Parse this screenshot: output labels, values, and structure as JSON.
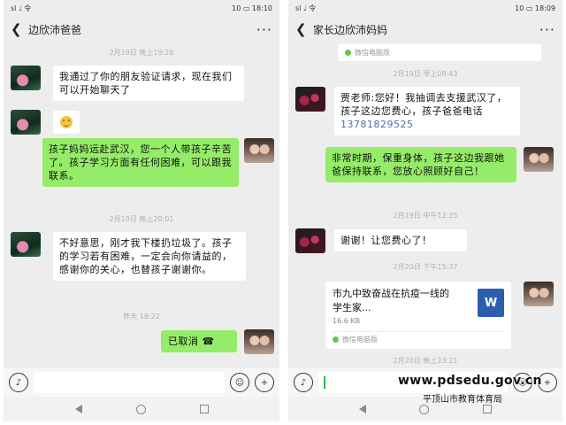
{
  "left_phone": {
    "status": {
      "left": "sl ♩ 令",
      "right": "10 ▭ 18:10"
    },
    "title": "边欣沛爸爸",
    "back_icon": "back-arrow-icon",
    "more_icon": "more-icon",
    "messages": [
      {
        "kind": "time",
        "text": "2月19日 晚上19:26"
      },
      {
        "kind": "in",
        "text": "我通过了你的朋友验证请求，现在我们可以开始聊天了"
      },
      {
        "kind": "in-emoji",
        "icon": "smile-emoji-icon"
      },
      {
        "kind": "out",
        "text": "孩子妈妈远赴武汉，您一个人带孩子辛苦了。孩子学习方面有任何困难，可以跟我联系。"
      },
      {
        "kind": "time",
        "text": "2月19日 晚上20:01"
      },
      {
        "kind": "in",
        "text": "不好意思，刚才我下楼扔垃圾了。孩子的学习若有困难，一定会向你请益的，感谢你的关心，也替孩子谢谢你。"
      },
      {
        "kind": "time",
        "text": "昨天 18:22"
      },
      {
        "kind": "out",
        "text": "已取消",
        "icon": "phone-hangup-icon"
      }
    ]
  },
  "right_phone": {
    "status": {
      "left": "sl ♩ 令",
      "right": "10 ▭ 18:09"
    },
    "title": "家长边欣沛妈妈",
    "back_icon": "back-arrow-icon",
    "more_icon": "more-icon",
    "messages": [
      {
        "kind": "source",
        "text": "微信电脑版"
      },
      {
        "kind": "time",
        "text": "2月19日 早上08:43"
      },
      {
        "kind": "in",
        "text": "贾老师:您好！我抽调去支援武汉了，孩子这边您费心，孩子爸爸电话",
        "phone": "13781829525"
      },
      {
        "kind": "out",
        "text": "非常时期，保重身体，孩子这边我跟她爸保持联系，您放心照顾好自己！"
      },
      {
        "kind": "time",
        "text": "2月19日 中午12:35"
      },
      {
        "kind": "in",
        "text": "谢谢！让您费心了！"
      },
      {
        "kind": "time",
        "text": "2月20日 下午15:37"
      },
      {
        "kind": "file",
        "title": "市九中致奋战在抗疫一线的学生家...",
        "size": "16.6 KB",
        "source": "微信电脑版",
        "badge": "W"
      },
      {
        "kind": "time",
        "text": "2月20日 晚上23:21"
      }
    ]
  },
  "input_bar": {
    "voice_icon": "voice-icon",
    "emoji_icon": "emoji-icon",
    "plus_icon": "plus-icon"
  },
  "watermark": {
    "url": "www.pdsedu.gov.cn",
    "org": "平顶山市教育体育局"
  }
}
